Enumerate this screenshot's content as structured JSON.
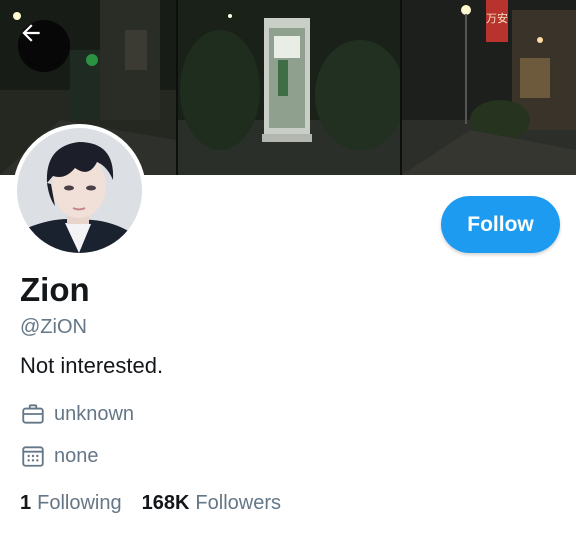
{
  "profile": {
    "display_name": "Zion",
    "handle": "@ZiON",
    "bio": "Not interested.",
    "work": "unknown",
    "joined": "none"
  },
  "actions": {
    "follow_label": "Follow"
  },
  "stats": {
    "following_count": "1",
    "following_label": "Following",
    "followers_count": "168K",
    "followers_label": "Followers"
  },
  "banner": {
    "sign_text": "万安"
  },
  "icons": {
    "back": "arrow-left-icon",
    "work": "briefcase-icon",
    "joined": "calendar-icon"
  },
  "colors": {
    "accent": "#1d9bf0",
    "text_primary": "#14171a",
    "text_secondary": "#657786"
  }
}
